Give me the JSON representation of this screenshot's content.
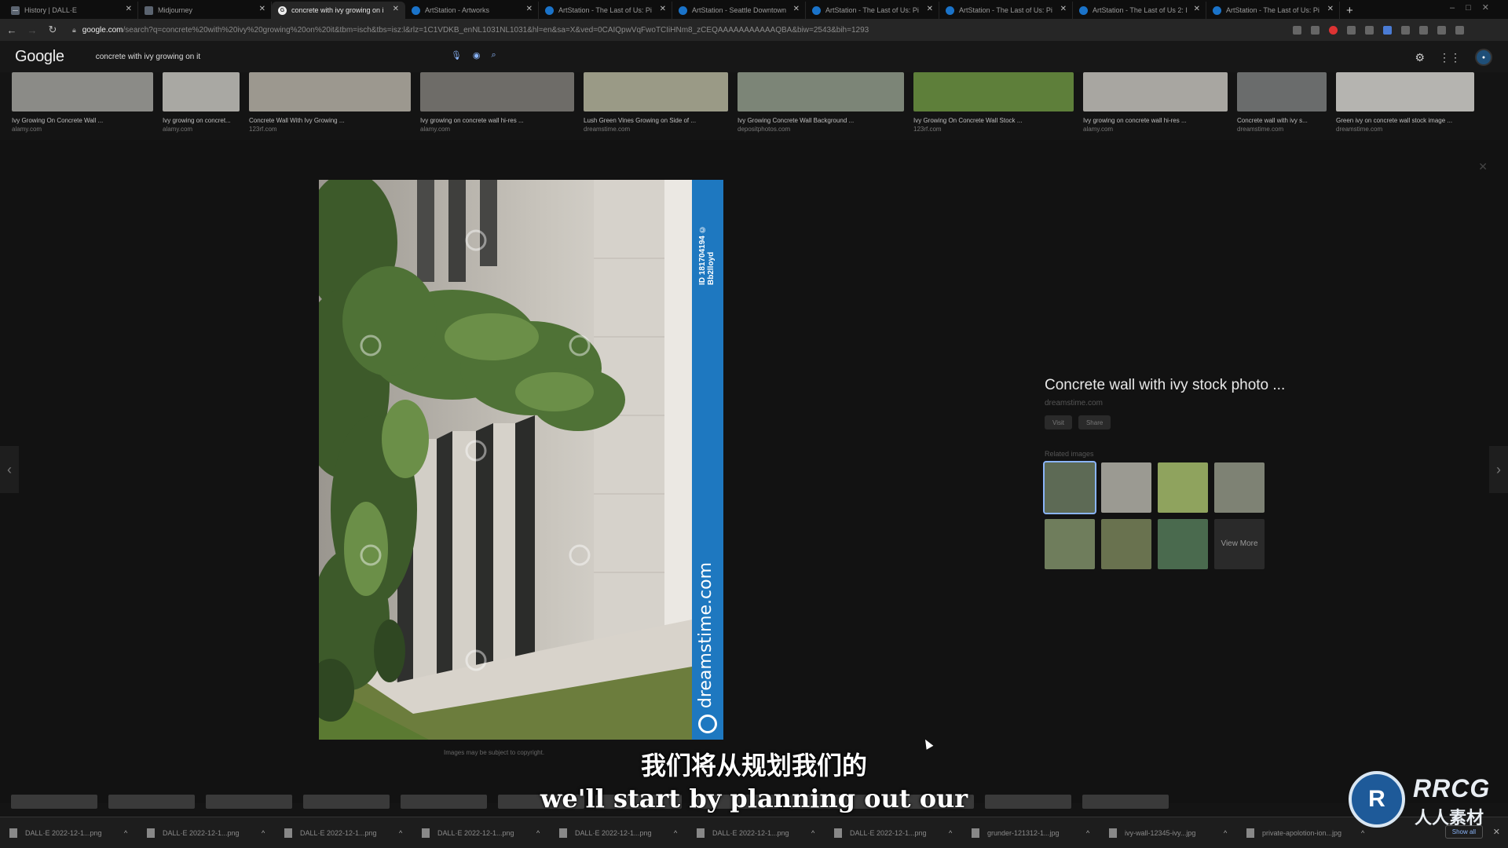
{
  "browser": {
    "tabs": [
      {
        "label": "History | DALL·E",
        "icon": "dalle-icon",
        "active": false
      },
      {
        "label": "Midjourney",
        "icon": "midjourney-icon",
        "active": false
      },
      {
        "label": "concrete with ivy growing on i",
        "icon": "google-icon",
        "active": true
      },
      {
        "label": "ArtStation - Artworks",
        "icon": "artstation-icon",
        "active": false
      },
      {
        "label": "ArtStation - The Last of Us: Pi",
        "icon": "artstation-icon",
        "active": false
      },
      {
        "label": "ArtStation - Seattle Downtown",
        "icon": "artstation-icon",
        "active": false
      },
      {
        "label": "ArtStation - The Last of Us: Pi",
        "icon": "artstation-icon",
        "active": false
      },
      {
        "label": "ArtStation - The Last of Us: Pi",
        "icon": "artstation-icon",
        "active": false
      },
      {
        "label": "ArtStation - The Last of Us 2: I",
        "icon": "artstation-icon",
        "active": false
      },
      {
        "label": "ArtStation - The Last of Us: Pi",
        "icon": "artstation-icon",
        "active": false
      }
    ],
    "url_host": "google.com",
    "url_path": "/search?q=concrete%20with%20ivy%20growing%20on%20it&tbm=isch&tbs=isz:l&rlz=1C1VDKB_enNL1031NL1031&hl=en&sa=X&ved=0CAIQpwVqFwoTCIiHNm8_zCEQAAAAAAAAAAAQBA&biw=2543&bih=1293"
  },
  "google": {
    "logo": "Google",
    "query": "concrete with ivy growing on it"
  },
  "results": [
    {
      "title": "Ivy Growing On Concrete Wall ...",
      "source": "alamy.com",
      "color": "#8b8b87"
    },
    {
      "title": "Ivy growing on concret...",
      "source": "alamy.com",
      "color": "#a9a8a3"
    },
    {
      "title": "Concrete Wall With Ivy Growing ...",
      "source": "123rf.com",
      "color": "#9c988f"
    },
    {
      "title": "Ivy growing on concrete wall hi-res ...",
      "source": "alamy.com",
      "color": "#6e6c68"
    },
    {
      "title": "Lush Green Vines Growing on Side of ...",
      "source": "dreamstime.com",
      "color": "#9a9a86"
    },
    {
      "title": "Ivy Growing Concrete Wall Background ...",
      "source": "depositphotos.com",
      "color": "#7c8577"
    },
    {
      "title": "Ivy Growing On Concrete Wall Stock ...",
      "source": "123rf.com",
      "color": "#5e7f3a"
    },
    {
      "title": "Ivy growing on concrete wall hi-res ...",
      "source": "alamy.com",
      "color": "#a8a6a1"
    },
    {
      "title": "Concrete wall with ivy s...",
      "source": "dreamstime.com",
      "color": "#6a6c6c"
    },
    {
      "title": "Green ivy on concrete wall stock image ...",
      "source": "dreamstime.com",
      "color": "#b5b4b0"
    }
  ],
  "preview": {
    "title": "Concrete wall with ivy stock photo ...",
    "source": "dreamstime.com",
    "buttons": [
      "Visit",
      "Share"
    ],
    "related_label": "Related images",
    "watermark_id": "ID 181704194 © Bb2lloyd",
    "watermark_brand": "dreamstime.com",
    "caption": "Images may be subject to copyright.",
    "view_more": "View More",
    "related": [
      {
        "color": "#5d6a55"
      },
      {
        "color": "#9b9a92"
      },
      {
        "color": "#8fa35e"
      },
      {
        "color": "#7e8274"
      },
      {
        "color": "#6f7d5c"
      },
      {
        "color": "#69724f"
      },
      {
        "color": "#4a6a4e"
      }
    ]
  },
  "subtitles": {
    "zh": "我们将从规划我们的",
    "en": "we'll start by planning out our"
  },
  "downloads": [
    {
      "name": "DALL·E 2022-12-1...png"
    },
    {
      "name": "DALL·E 2022-12-1...png"
    },
    {
      "name": "DALL·E 2022-12-1...png"
    },
    {
      "name": "DALL·E 2022-12-1...png"
    },
    {
      "name": "DALL·E 2022-12-1...png"
    },
    {
      "name": "DALL·E 2022-12-1...png"
    },
    {
      "name": "DALL·E 2022-12-1...png"
    },
    {
      "name": "grunder-121312-1...jpg"
    },
    {
      "name": "ivy-wall-12345-ivy...jpg"
    },
    {
      "name": "private-apolotion-ion...jpg"
    }
  ],
  "downloads_show_all": "Show all",
  "brand": {
    "logo_mark": "R",
    "name": "RRCG",
    "cn": "人人素材"
  }
}
